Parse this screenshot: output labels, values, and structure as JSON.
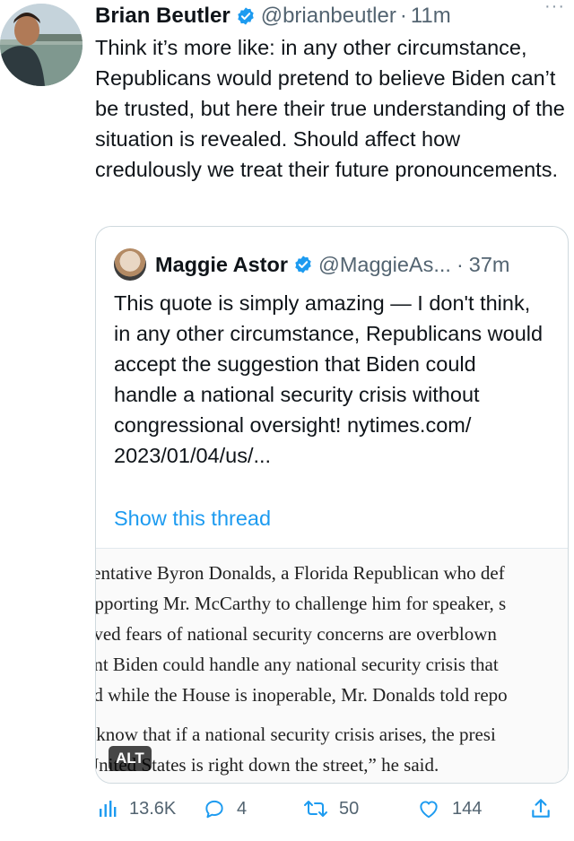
{
  "tweet": {
    "author_name": "Brian Beutler",
    "author_handle": "@brianbeutler",
    "timestamp": "11m",
    "separator": "·",
    "more": "···",
    "text": "Think it’s more like: in any other circumstance, Republicans would pretend to believe Biden can’t be trusted, but here their true understanding of the situation is revealed. Should affect how credulously we treat their future pronouncements.",
    "verified_icon": "verified-badge-icon"
  },
  "quote": {
    "author_name": "Maggie Astor",
    "author_handle": "@MaggieAs...",
    "timestamp": "37m",
    "separator": "·",
    "text": "This quote is simply amazing — I don't think, in any other circumstance, Republicans would accept the suggestion that Biden could handle a national security crisis without congressional oversight! nytimes.com/ 2023/01/04/us/...",
    "show_thread": "Show this thread",
    "image": {
      "paragraph1": [
        "sentative Byron Donalds, a Florida Republican who def",
        "upporting Mr. McCarthy to challenge him for speaker, s",
        "eved fears of national security concerns are overblown",
        "ent Biden could handle any national security crisis that",
        "ed while the House is inoperable, Mr. Donalds told repo"
      ],
      "paragraph2": [
        "I know that if a national security crisis arises, the presi",
        "United States is right down the street,” he said."
      ],
      "alt_label": "ALT"
    }
  },
  "actions": {
    "views": "13.6K",
    "replies": "4",
    "retweets": "50",
    "likes": "144"
  },
  "colors": {
    "link": "#1d9bf0",
    "secondary_text": "#536471",
    "verified": "#1d9bf0",
    "border": "#cfd9de"
  }
}
